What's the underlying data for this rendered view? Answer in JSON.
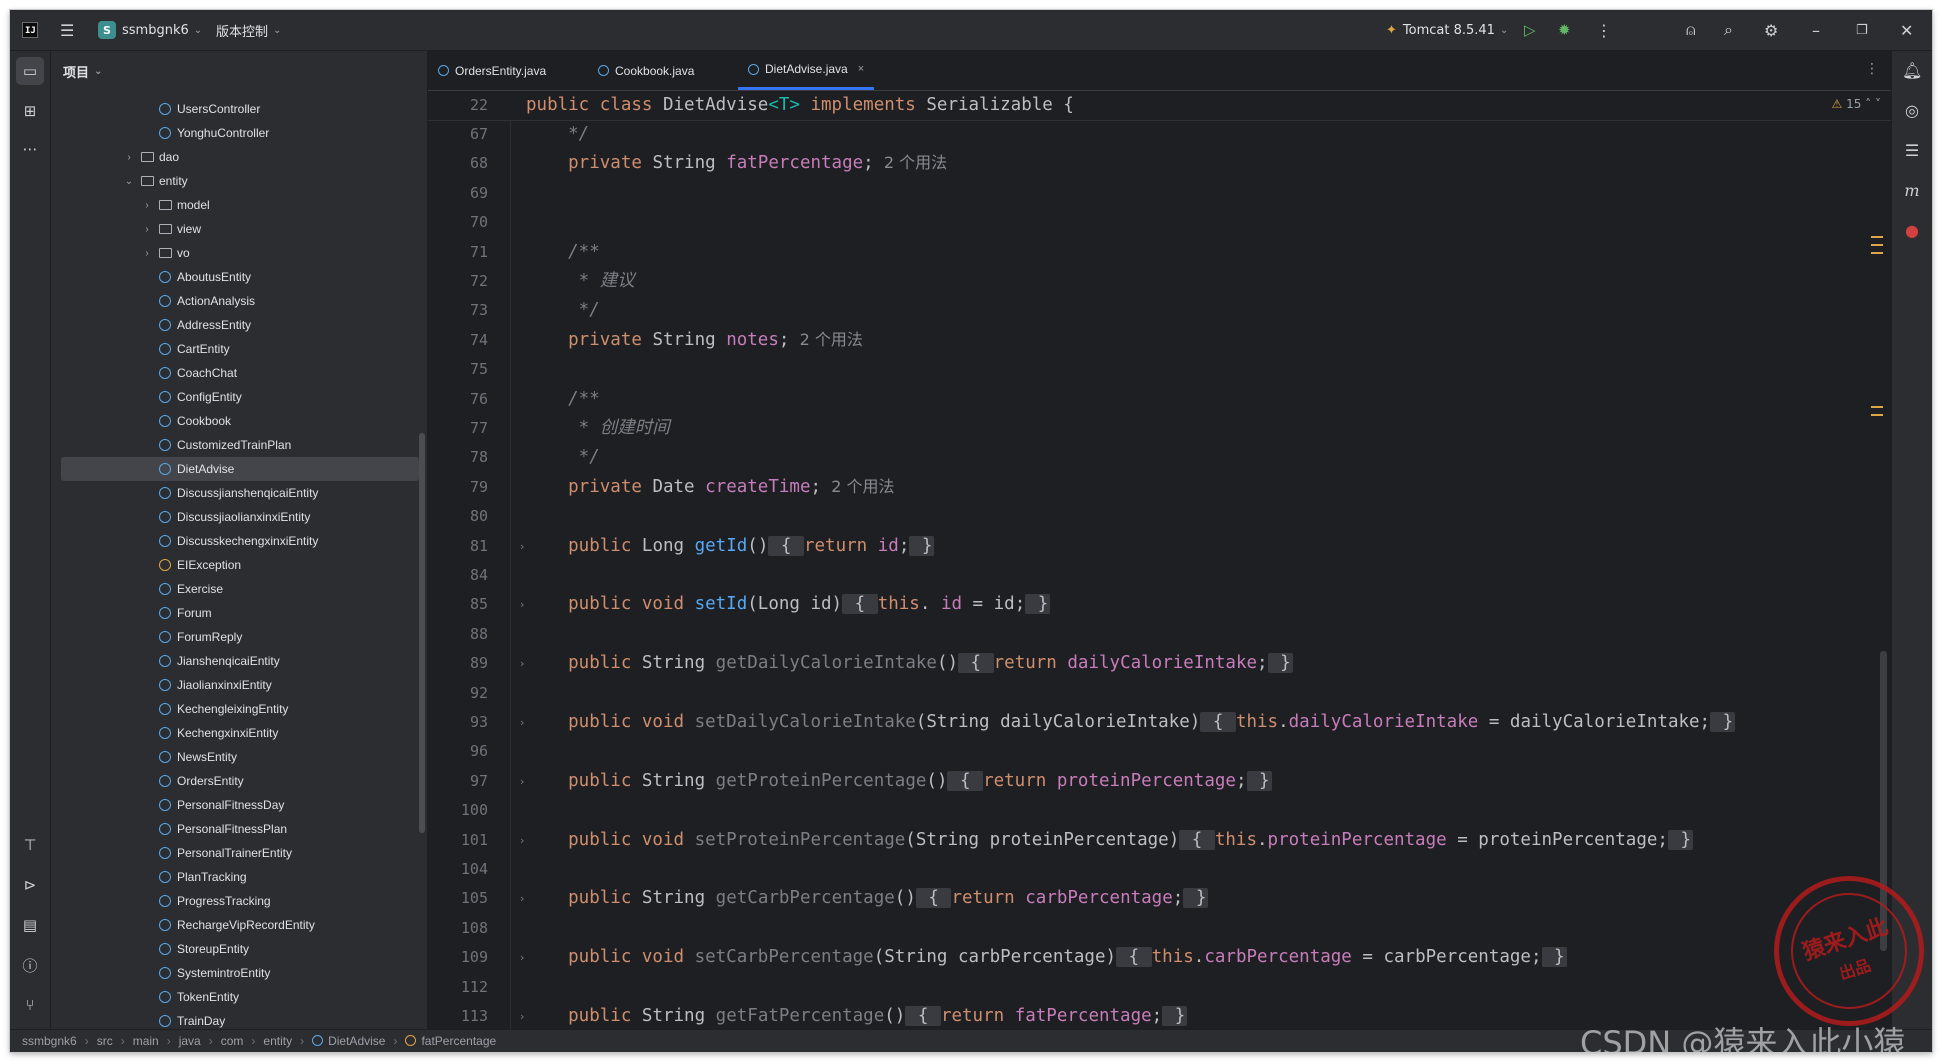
{
  "titlebar": {
    "project_badge": "S",
    "project_name": "ssmbgnk6",
    "vcs_label": "版本控制",
    "run_config": "Tomcat 8.5.41"
  },
  "panel": {
    "title": "项目"
  },
  "tree": [
    {
      "label": "UsersController",
      "kind": "class",
      "depth": 4
    },
    {
      "label": "YonghuController",
      "kind": "class",
      "depth": 4
    },
    {
      "label": "dao",
      "kind": "folder",
      "depth": 3,
      "arrow": "›"
    },
    {
      "label": "entity",
      "kind": "folder",
      "depth": 3,
      "arrow": "⌄"
    },
    {
      "label": "model",
      "kind": "folder",
      "depth": 4,
      "arrow": "›"
    },
    {
      "label": "view",
      "kind": "folder",
      "depth": 4,
      "arrow": "›"
    },
    {
      "label": "vo",
      "kind": "folder",
      "depth": 4,
      "arrow": "›"
    },
    {
      "label": "AboutusEntity",
      "kind": "class",
      "depth": 4
    },
    {
      "label": "ActionAnalysis",
      "kind": "class",
      "depth": 4
    },
    {
      "label": "AddressEntity",
      "kind": "class",
      "depth": 4
    },
    {
      "label": "CartEntity",
      "kind": "class",
      "depth": 4
    },
    {
      "label": "CoachChat",
      "kind": "class",
      "depth": 4
    },
    {
      "label": "ConfigEntity",
      "kind": "class",
      "depth": 4
    },
    {
      "label": "Cookbook",
      "kind": "class",
      "depth": 4
    },
    {
      "label": "CustomizedTrainPlan",
      "kind": "class",
      "depth": 4
    },
    {
      "label": "DietAdvise",
      "kind": "class",
      "depth": 4,
      "selected": true
    },
    {
      "label": "DiscussjianshenqicaiEntity",
      "kind": "class",
      "depth": 4
    },
    {
      "label": "DiscussjiaolianxinxiEntity",
      "kind": "class",
      "depth": 4
    },
    {
      "label": "DiscusskechengxinxiEntity",
      "kind": "class",
      "depth": 4
    },
    {
      "label": "EIException",
      "kind": "exception",
      "depth": 4
    },
    {
      "label": "Exercise",
      "kind": "class",
      "depth": 4
    },
    {
      "label": "Forum",
      "kind": "class",
      "depth": 4
    },
    {
      "label": "ForumReply",
      "kind": "class",
      "depth": 4
    },
    {
      "label": "JianshenqicaiEntity",
      "kind": "class",
      "depth": 4
    },
    {
      "label": "JiaolianxinxiEntity",
      "kind": "class",
      "depth": 4
    },
    {
      "label": "KechengleixingEntity",
      "kind": "class",
      "depth": 4
    },
    {
      "label": "KechengxinxiEntity",
      "kind": "class",
      "depth": 4
    },
    {
      "label": "NewsEntity",
      "kind": "class",
      "depth": 4
    },
    {
      "label": "OrdersEntity",
      "kind": "class",
      "depth": 4
    },
    {
      "label": "PersonalFitnessDay",
      "kind": "class",
      "depth": 4
    },
    {
      "label": "PersonalFitnessPlan",
      "kind": "class",
      "depth": 4
    },
    {
      "label": "PersonalTrainerEntity",
      "kind": "class",
      "depth": 4
    },
    {
      "label": "PlanTracking",
      "kind": "class",
      "depth": 4
    },
    {
      "label": "ProgressTracking",
      "kind": "class",
      "depth": 4
    },
    {
      "label": "RechargeVipRecordEntity",
      "kind": "class",
      "depth": 4
    },
    {
      "label": "StoreupEntity",
      "kind": "class",
      "depth": 4
    },
    {
      "label": "SystemintroEntity",
      "kind": "class",
      "depth": 4
    },
    {
      "label": "TokenEntity",
      "kind": "class",
      "depth": 4
    },
    {
      "label": "TrainDay",
      "kind": "class",
      "depth": 4
    }
  ],
  "tabs": [
    {
      "label": "OrdersEntity.java",
      "active": false
    },
    {
      "label": "Cookbook.java",
      "active": false
    },
    {
      "label": "DietAdvise.java",
      "active": true,
      "close": "×"
    }
  ],
  "editor": {
    "warnings": "15",
    "sticky": {
      "num": "22",
      "segments": [
        [
          "k",
          "public class "
        ],
        [
          "",
          "DietAdvise"
        ],
        [
          "tp",
          "<T>"
        ],
        [
          "k",
          " implements "
        ],
        [
          "",
          "Serializable {"
        ]
      ]
    },
    "lines": [
      {
        "num": "67",
        "segments": [
          [
            "cd",
            "    */"
          ]
        ]
      },
      {
        "num": "68",
        "segments": [
          [
            "k",
            "    private "
          ],
          [
            "",
            "String "
          ],
          [
            "f",
            "fatPercentage"
          ],
          [
            "",
            ";"
          ],
          [
            "hint",
            "  2 个用法"
          ]
        ]
      },
      {
        "num": "69",
        "segments": []
      },
      {
        "num": "70",
        "segments": []
      },
      {
        "num": "71",
        "segments": [
          [
            "cd",
            "    /**"
          ]
        ]
      },
      {
        "num": "72",
        "segments": [
          [
            "cd",
            "     * 建议"
          ]
        ]
      },
      {
        "num": "73",
        "segments": [
          [
            "cd",
            "     */"
          ]
        ]
      },
      {
        "num": "74",
        "segments": [
          [
            "k",
            "    private "
          ],
          [
            "",
            "String "
          ],
          [
            "f",
            "notes"
          ],
          [
            "",
            ";"
          ],
          [
            "hint",
            "  2 个用法"
          ]
        ]
      },
      {
        "num": "75",
        "segments": []
      },
      {
        "num": "76",
        "segments": [
          [
            "cd",
            "    /**"
          ]
        ]
      },
      {
        "num": "77",
        "segments": [
          [
            "cd",
            "     * 创建时间"
          ]
        ]
      },
      {
        "num": "78",
        "segments": [
          [
            "cd",
            "     */"
          ]
        ]
      },
      {
        "num": "79",
        "segments": [
          [
            "k",
            "    private "
          ],
          [
            "",
            "Date "
          ],
          [
            "f",
            "createTime"
          ],
          [
            "",
            ";"
          ],
          [
            "hint",
            "  2 个用法"
          ]
        ]
      },
      {
        "num": "80",
        "segments": []
      },
      {
        "num": "81",
        "fold": true,
        "segments": [
          [
            "k",
            "    public "
          ],
          [
            "",
            "Long "
          ],
          [
            "m",
            "getId"
          ],
          [
            "",
            "()"
          ],
          [
            "br",
            " { "
          ],
          [
            "k",
            "return "
          ],
          [
            "f",
            "id"
          ],
          [
            "",
            ";"
          ],
          [
            "br",
            " }"
          ]
        ]
      },
      {
        "num": "84",
        "segments": []
      },
      {
        "num": "85",
        "fold": true,
        "segments": [
          [
            "k",
            "    public void "
          ],
          [
            "m",
            "setId"
          ],
          [
            "",
            "(Long id)"
          ],
          [
            "br",
            " { "
          ],
          [
            "k",
            "this"
          ],
          [
            "",
            ". "
          ],
          [
            "f",
            "id"
          ],
          [
            "",
            " = id;"
          ],
          [
            "br",
            " }"
          ]
        ]
      },
      {
        "num": "88",
        "segments": []
      },
      {
        "num": "89",
        "fold": true,
        "segments": [
          [
            "k",
            "    public "
          ],
          [
            "",
            "String "
          ],
          [
            "c",
            "getDailyCalorieIntake"
          ],
          [
            "",
            "()"
          ],
          [
            "br",
            " { "
          ],
          [
            "k",
            "return "
          ],
          [
            "f",
            "dailyCalorieIntake"
          ],
          [
            "",
            ";"
          ],
          [
            "br",
            " }"
          ]
        ]
      },
      {
        "num": "92",
        "segments": []
      },
      {
        "num": "93",
        "fold": true,
        "segments": [
          [
            "k",
            "    public void "
          ],
          [
            "c",
            "setDailyCalorieIntake"
          ],
          [
            "",
            "(String dailyCalorieIntake)"
          ],
          [
            "br",
            " { "
          ],
          [
            "k",
            "this"
          ],
          [
            "",
            "."
          ],
          [
            "f",
            "dailyCalorieIntake"
          ],
          [
            "",
            " = dailyCalorieIntake;"
          ],
          [
            "br",
            " }"
          ]
        ]
      },
      {
        "num": "96",
        "segments": []
      },
      {
        "num": "97",
        "fold": true,
        "segments": [
          [
            "k",
            "    public "
          ],
          [
            "",
            "String "
          ],
          [
            "c",
            "getProteinPercentage"
          ],
          [
            "",
            "()"
          ],
          [
            "br",
            " { "
          ],
          [
            "k",
            "return "
          ],
          [
            "f",
            "proteinPercentage"
          ],
          [
            "",
            ";"
          ],
          [
            "br",
            " }"
          ]
        ]
      },
      {
        "num": "100",
        "segments": []
      },
      {
        "num": "101",
        "fold": true,
        "segments": [
          [
            "k",
            "    public void "
          ],
          [
            "c",
            "setProteinPercentage"
          ],
          [
            "",
            "(String proteinPercentage)"
          ],
          [
            "br",
            " { "
          ],
          [
            "k",
            "this"
          ],
          [
            "",
            "."
          ],
          [
            "f",
            "proteinPercentage"
          ],
          [
            "",
            " = proteinPercentage;"
          ],
          [
            "br",
            " }"
          ]
        ]
      },
      {
        "num": "104",
        "segments": []
      },
      {
        "num": "105",
        "fold": true,
        "segments": [
          [
            "k",
            "    public "
          ],
          [
            "",
            "String "
          ],
          [
            "c",
            "getCarbPercentage"
          ],
          [
            "",
            "()"
          ],
          [
            "br",
            " { "
          ],
          [
            "k",
            "return "
          ],
          [
            "f",
            "carbPercentage"
          ],
          [
            "",
            ";"
          ],
          [
            "br",
            " }"
          ]
        ]
      },
      {
        "num": "108",
        "segments": []
      },
      {
        "num": "109",
        "fold": true,
        "segments": [
          [
            "k",
            "    public void "
          ],
          [
            "c",
            "setCarbPercentage"
          ],
          [
            "",
            "(String carbPercentage)"
          ],
          [
            "br",
            " { "
          ],
          [
            "k",
            "this"
          ],
          [
            "",
            "."
          ],
          [
            "f",
            "carbPercentage"
          ],
          [
            "",
            " = carbPercentage;"
          ],
          [
            "br",
            " }"
          ]
        ]
      },
      {
        "num": "112",
        "segments": []
      },
      {
        "num": "113",
        "fold": true,
        "segments": [
          [
            "k",
            "    public "
          ],
          [
            "",
            "String "
          ],
          [
            "c",
            "getFatPercentage"
          ],
          [
            "",
            "()"
          ],
          [
            "br",
            " { "
          ],
          [
            "k",
            "return "
          ],
          [
            "f",
            "fatPercentage"
          ],
          [
            "",
            ";"
          ],
          [
            "br",
            " }"
          ]
        ]
      }
    ]
  },
  "statusbar": {
    "crumbs": [
      "ssmbgnk6",
      "src",
      "main",
      "java",
      "com",
      "entity",
      "DietAdvise",
      "fatPercentage"
    ]
  },
  "watermark": {
    "stamp_main": "猿来入此",
    "stamp_sub": "出品",
    "csdn": "CSDN @猿来入此小猿"
  },
  "colors": {
    "background": "#1e1f22",
    "panel": "#2b2d30",
    "keyword": "#cf8e6d",
    "field": "#c77dbb",
    "method": "#56a8f5",
    "comment": "#7a7e85",
    "accent": "#3574f0"
  },
  "icons": [
    "intellij-logo-icon",
    "hamburger-menu-icon",
    "run-icon",
    "debug-icon",
    "more-icon",
    "add-user-icon",
    "search-icon",
    "settings-icon",
    "minimize-icon",
    "maximize-icon",
    "close-icon",
    "project-folder-icon",
    "structure-icon",
    "notifications-icon",
    "database-icon",
    "maven-icon"
  ]
}
